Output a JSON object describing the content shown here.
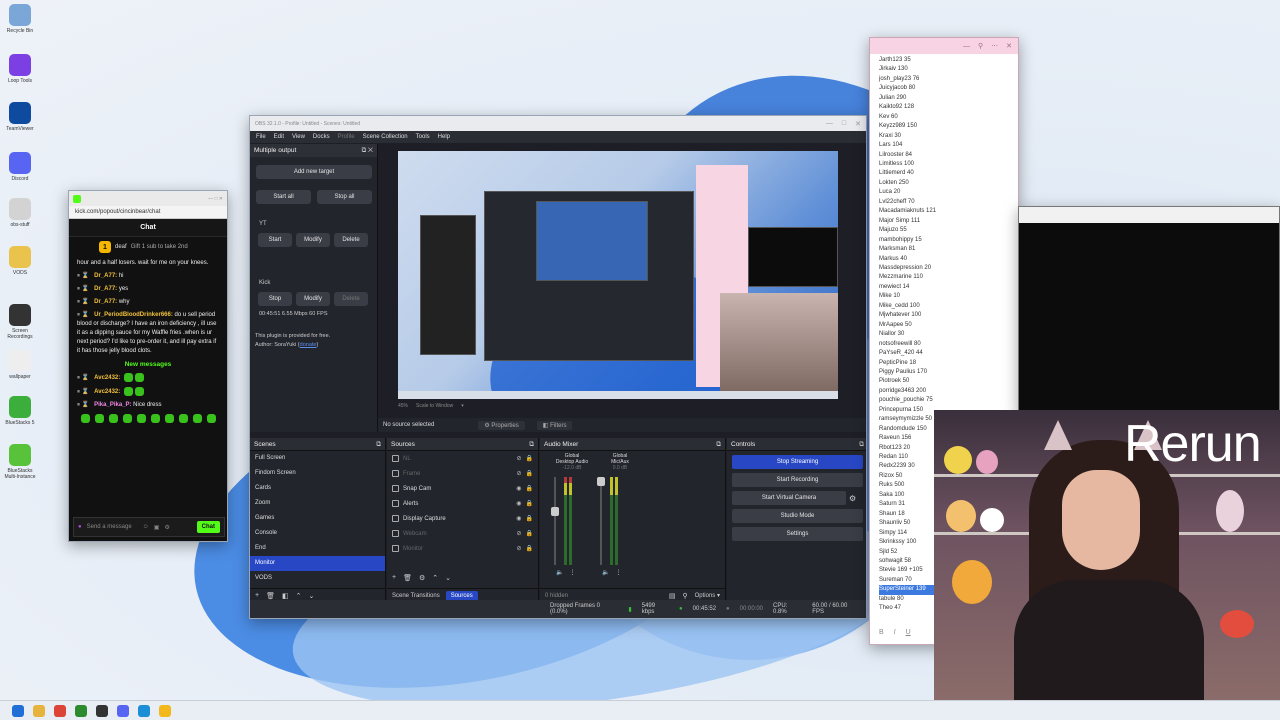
{
  "desktop": {
    "icons": [
      {
        "label": "Recycle Bin",
        "icon": "recycle-bin-icon",
        "color": "#7aa7d8"
      },
      {
        "label": "Loop Tools",
        "icon": "audio-app-icon",
        "color": "#7b3fe4"
      },
      {
        "label": "TeamViewer",
        "icon": "teamviewer-icon",
        "color": "#0e4a9e"
      },
      {
        "label": "Discord",
        "icon": "discord-icon",
        "color": "#5865f2"
      },
      {
        "label": "obs-stuff",
        "icon": "file-icon",
        "color": "#d3d3d3"
      },
      {
        "label": "VODS",
        "icon": "folder-icon",
        "color": "#e9c34c"
      },
      {
        "label": "Screen Recordings",
        "icon": "folder-icon",
        "color": "#333333"
      },
      {
        "label": "wallpaper",
        "icon": "file-icon",
        "color": "#eeeeee"
      },
      {
        "label": "BlueStacks 5",
        "icon": "bluestacks-icon",
        "color": "#3cae3c"
      },
      {
        "label": "BlueStacks Multi-Instance",
        "icon": "bluestacks-icon",
        "color": "#58c23b"
      }
    ]
  },
  "chat_window": {
    "url": "kick.com/popout/cincinbear/chat",
    "header": "Chat",
    "pinned": {
      "badge": "1",
      "user": "deaf",
      "text": "Gift 1 sub to take 2nd"
    },
    "first_line": "hour and a half losers. wait for me on your knees.",
    "messages": [
      {
        "user": "Dr_A77:",
        "text": "hi"
      },
      {
        "user": "Dr_A77:",
        "text": "yes"
      },
      {
        "user": "Dr_A77:",
        "text": "why"
      },
      {
        "user": "Ur_PeriodBloodDrinker666:",
        "text": "do u sell period blood or discharge? I have an iron deficiency , ill use it as a dipping sauce for my Waffle fries .when is ur next period? I'd like to pre-order it, and ill pay extra if it has those jelly blood clots."
      }
    ],
    "new_messages_label": "New messages",
    "new_messages": [
      {
        "user": "Avc2432:",
        "text": ""
      },
      {
        "user": "Avc2432:",
        "text": ""
      },
      {
        "user": "Pika_Pika_P:",
        "text": "Nice dress"
      }
    ],
    "input_placeholder": "Send a message",
    "send_label": "Chat",
    "accent": "#53fc18"
  },
  "obs": {
    "title": "OBS 32.1.0 - Profile: Untitled - Scenes: Untitled",
    "menu": [
      "File",
      "Edit",
      "View",
      "Docks",
      "Profile",
      "Scene Collection",
      "Tools",
      "Help"
    ],
    "multiple_output": {
      "title": "Multiple output",
      "add_target": "Add new target",
      "start_all": "Start all",
      "stop_all": "Stop all",
      "yt_label": "YT",
      "yt_buttons": [
        "Start",
        "Modify",
        "Delete"
      ],
      "kick_label": "Kick",
      "kick_buttons": [
        "Stop",
        "Modify",
        "Delete"
      ],
      "kick_stats": "00:45:51  6.55 Mbps  60 FPS",
      "plugin_note": "This plugin is provided for free.",
      "author": "Author: SoraYuki (",
      "author_link": "donate",
      "author_end": ")"
    },
    "zoom": "45%",
    "scale_label": "Scale to Window",
    "no_source": "No source selected",
    "properties": "Properties",
    "filters": "Filters",
    "scenes": {
      "title": "Scenes",
      "items": [
        "Full Screen",
        "Findom Screen",
        "Cards",
        "Zoom",
        "Games",
        "Console",
        "End",
        "Monitor",
        "VODS"
      ],
      "active": "Monitor"
    },
    "sources": {
      "title": "Sources",
      "items": [
        {
          "name": "NL",
          "visible": false
        },
        {
          "name": "Frame",
          "visible": false
        },
        {
          "name": "Snap Cam",
          "visible": true
        },
        {
          "name": "Alerts",
          "visible": true
        },
        {
          "name": "Display Capture",
          "visible": true
        },
        {
          "name": "Webcam",
          "visible": false
        },
        {
          "name": "Monitor",
          "visible": false
        }
      ],
      "tab_transitions": "Scene Transitions",
      "tab_sources": "Sources"
    },
    "mixer": {
      "title": "Audio Mixer",
      "channels": [
        {
          "name": "Global",
          "sub": "Desktop Audio",
          "db": "-12.0 dB"
        },
        {
          "name": "Global",
          "sub": "Mic/Aux",
          "db": "0.0 dB"
        }
      ],
      "hidden": "0 hidden",
      "options": "Options"
    },
    "controls": {
      "title": "Controls",
      "buttons": [
        "Stop Streaming",
        "Start Recording",
        "Start Virtual Camera",
        "Studio Mode",
        "Settings"
      ]
    },
    "status": {
      "dropped": "Dropped Frames 0 (0.0%)",
      "kbps": "5499 kbps",
      "stream_time": "00:45:52",
      "rec_time": "00:00:00",
      "cpu": "CPU: 0.8%",
      "fps": "60.00 / 60.00 FPS"
    },
    "accent": "#2747c5"
  },
  "viewers": {
    "list": [
      "Jarth123 35",
      "Jirkaiv 130",
      "josh_play23 76",
      "Juicyjacob 80",
      "Julian 290",
      "Kaikto92 128",
      "Kev 60",
      "Keyzz989 150",
      "Kraxi 30",
      "Lars 104",
      "Lilrooster 84",
      "Limitless 100",
      "Littiemerd 40",
      "Lokten 250",
      "Luca 20",
      "Lvl22cheff 70",
      "Macadamiaknuts 121",
      "Major Simp 111",
      "Majuzo 55",
      "mambohippy 15",
      "Marksman 81",
      "Markus 40",
      "Massdepression 20",
      "Mezzmarine 110",
      "mewiect 14",
      "Mike 10",
      "Mike_cedd 100",
      "Mjwhatever 100",
      "MrAapee 50",
      "Niallor 30",
      "notsofreewill 80",
      "PaYseR_420 44",
      "PepticPine 18",
      "Piggy Paulius 170",
      "Piotroek 50",
      "porridge3463 200",
      "pouchie_pouchie 75",
      "Princepurna 150",
      "ramseymymizzle 50",
      "Randomdude 150",
      "Raveun 156",
      "Rbot123 20",
      "Redan 110",
      "Redx2239 30",
      "Rizox 50",
      "Ruks 500",
      "Saka 100",
      "Saturn 31",
      "Shaun 18",
      "Shaunliv 50",
      "Simpy 114",
      "Skrinkssy 100",
      "Sjld 52",
      "sohwagit 58",
      "Stevie 169 +105",
      "Sureman 70",
      "SuperSteiner 139",
      "tabule 80",
      "Theo 47"
    ],
    "selected": "SuperSteiner 139",
    "bg": "#f8d3e3"
  },
  "webcam": {
    "overlay": "Rerun"
  },
  "taskbar": {
    "icons": [
      {
        "icon": "windows-start-icon",
        "color": "#1f6fd6"
      },
      {
        "icon": "file-explorer-icon",
        "color": "#e6b43c"
      },
      {
        "icon": "chrome-icon",
        "color": "#db4437"
      },
      {
        "icon": "xbox-icon",
        "color": "#2c8b2c"
      },
      {
        "icon": "obs-icon",
        "color": "#333333"
      },
      {
        "icon": "discord-icon",
        "color": "#5865f2"
      },
      {
        "icon": "edge-icon",
        "color": "#1b8fd6"
      },
      {
        "icon": "sticky-notes-icon",
        "color": "#f2b81c"
      }
    ]
  }
}
